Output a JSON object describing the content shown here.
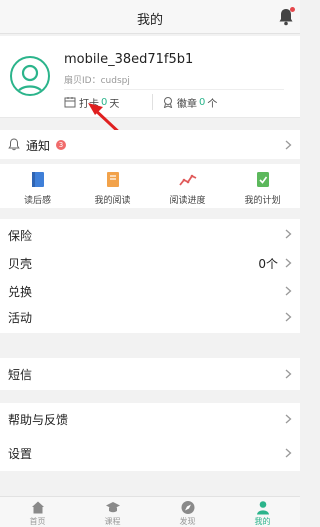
{
  "header": {
    "title": "我的"
  },
  "profile": {
    "username": "mobile_38ed71f5b1",
    "shell_id": "扇贝ID：cudspj",
    "checkin": {
      "label": "打卡",
      "count": "0",
      "unit": "天"
    },
    "badge": {
      "label": "徽章",
      "count": "0",
      "unit": "个"
    }
  },
  "notification": {
    "label": "通知",
    "count": "3"
  },
  "quick_actions": [
    {
      "label": "读后感",
      "icon": "book-icon"
    },
    {
      "label": "我的阅读",
      "icon": "reading-icon"
    },
    {
      "label": "阅读进度",
      "icon": "progress-chart-icon"
    },
    {
      "label": "我的计划",
      "icon": "plan-icon"
    }
  ],
  "menu_group_1": [
    {
      "label": "保险",
      "value": ""
    },
    {
      "label": "贝壳",
      "value": "0个"
    },
    {
      "label": "兑换",
      "value": ""
    },
    {
      "label": "活动",
      "value": ""
    }
  ],
  "menu_group_2": [
    {
      "label": "短信",
      "value": ""
    }
  ],
  "menu_group_3": [
    {
      "label": "帮助与反馈",
      "value": ""
    },
    {
      "label": "设置",
      "value": ""
    }
  ],
  "tabbar": [
    {
      "label": "首页",
      "icon": "home-icon"
    },
    {
      "label": "课程",
      "icon": "graduation-cap-icon"
    },
    {
      "label": "发现",
      "icon": "compass-icon"
    },
    {
      "label": "我的",
      "icon": "user-icon"
    }
  ],
  "colors": {
    "accent": "#2bb48b",
    "alert": "#e5484d",
    "annotation": "#e02020"
  }
}
